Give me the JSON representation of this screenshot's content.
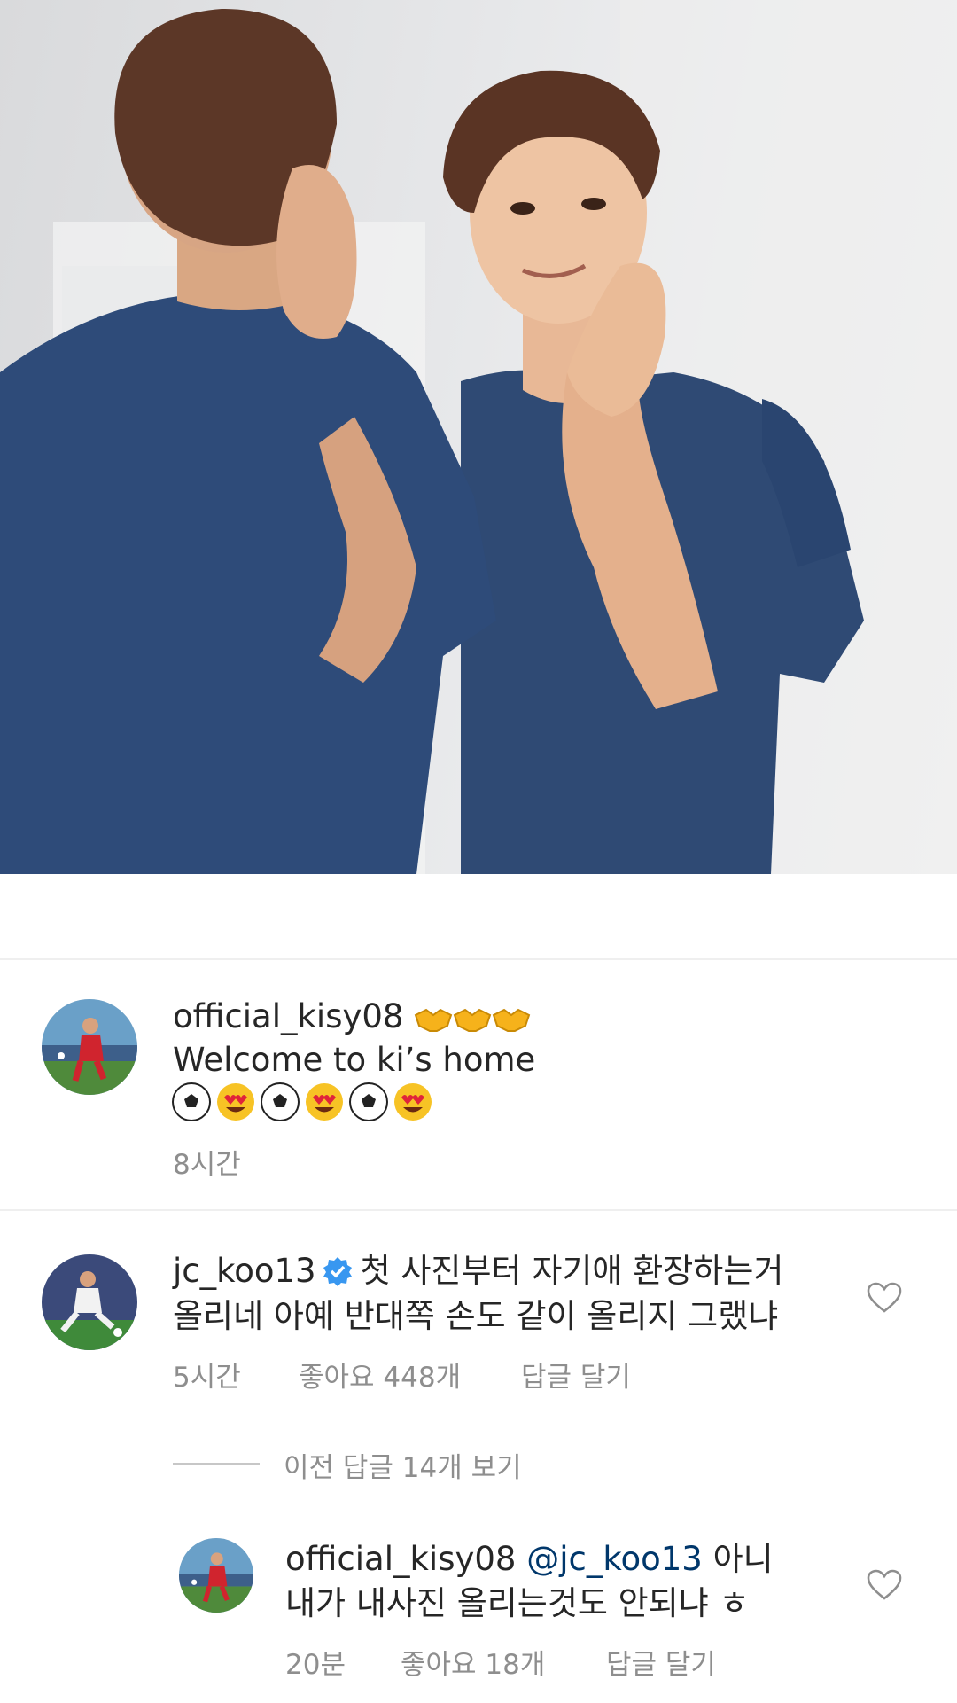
{
  "caption": {
    "username": "official_kisy08",
    "text": "Welcome to ki’s home",
    "time": "8시간",
    "handshake_icons": [
      "handshake-icon",
      "handshake-icon",
      "handshake-icon"
    ],
    "emoji_icons": [
      "soccer-ball-icon",
      "heart-eyes-icon",
      "soccer-ball-icon",
      "heart-eyes-icon",
      "soccer-ball-icon",
      "heart-eyes-icon"
    ]
  },
  "comment": {
    "username": "jc_koo13",
    "text_line1": "첫 사진부터 자기애 환장하는거",
    "text_line2": "올리네 아예 반대쪽 손도 같이 올리지 그랬냐",
    "time": "5시간",
    "likes": "좋아요 448개",
    "reply_label": "답글 달기"
  },
  "view_replies_label": "이전 답글 14개 보기",
  "reply": {
    "username": "official_kisy08",
    "mention": "@jc_koo13",
    "text_line1_end": "아니",
    "text_line2": "내가 내사진 올리는것도 안되냐 ㅎ",
    "time": "20분",
    "likes": "좋아요 18개",
    "reply_label": "답글 달기"
  },
  "colors": {
    "text": "#262626",
    "meta": "#8e8e8e",
    "mention": "#00376b",
    "verified": "#3897f0"
  }
}
